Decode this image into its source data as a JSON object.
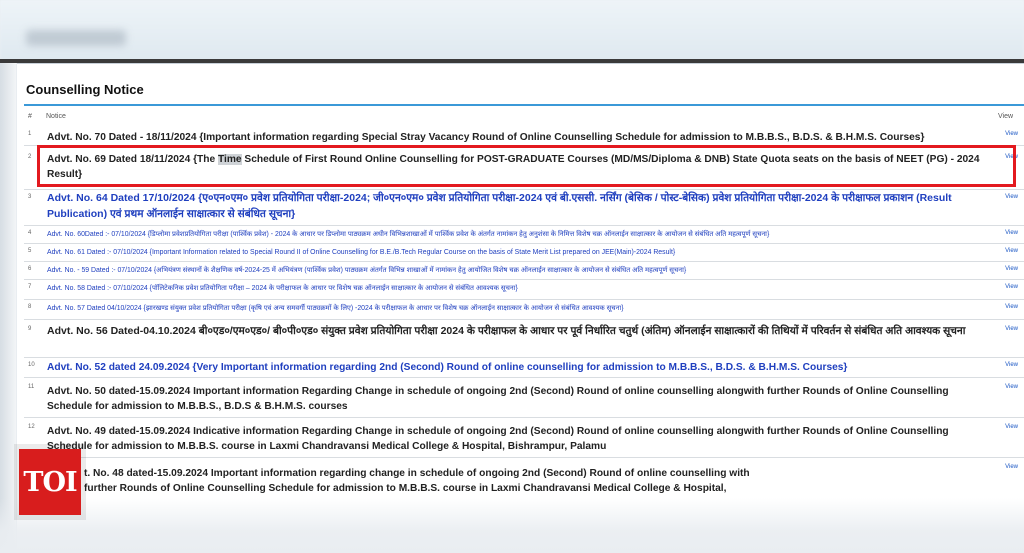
{
  "panel": {
    "title": "Counselling Notice",
    "headers": {
      "num": "#",
      "notice": "Notice",
      "view": "View"
    }
  },
  "rows": [
    {
      "num": "1",
      "view": "View",
      "text": "Advt. No. 70 Dated - 18/11/2024 {Important information regarding Special Stray Vacancy Round of Online Counselling Schedule for admission to M.B.B.S., B.D.S. & B.H.M.S. Courses}"
    },
    {
      "num": "2",
      "view": "View",
      "text_pre": "Advt. No. 69 Dated 18/11/2024 {The ",
      "text_hl": "Time",
      "text_post": " Schedule of First Round Online Counselling for POST-GRADUATE Courses (MD/MS/Diploma & DNB) State Quota seats on the basis of NEET (PG) - 2024 Result}"
    },
    {
      "num": "3",
      "view": "View",
      "text": "Advt. No. 64 Dated 17/10/2024 {ए०एन०एम० प्रवेश प्रतियोगिता परीक्षा-2024; जी०एन०एम० प्रवेश प्रतियोगिता परीक्षा-2024 एवं बी.एससी. नर्सिंग (बेसिक / पोस्ट-बेसिक) प्रवेश प्रतियोगिता परीक्षा-2024 के परीक्षाफल प्रकाशन (Result Publication) एवं प्रथम ऑनलाईन साक्षात्कार से संबंधित सूचना}"
    },
    {
      "num": "4",
      "view": "View",
      "text": "Advt. No. 60Dated :- 07/10/2024 {डिप्लोमा प्रवेशप्रतियोगिता परीक्षा (पार्श्विक प्रवेश) - 2024 के आधार पर डिप्लोमा पाठ्यक्रम अधीन विभिन्नशाखाओं में पार्श्विक प्रवेश के अंतर्गत नामांकन हेतु अनुशंसा के निमित्त विशेष चक्र ऑनलाईन साक्षात्कार के आयोजन से संबंधित अति महत्वपूर्ण सूचना}"
    },
    {
      "num": "5",
      "view": "View",
      "text": "Advt. No. 61 Dated :- 07/10/2024 {Important Information related to Special Round II of Online Counselling for B.E./B.Tech Regular Course on the basis of State Merit List prepared on JEE(Main)-2024 Result}"
    },
    {
      "num": "6",
      "view": "View",
      "text": "Advt. No. - 59 Dated :- 07/10/2024 {अभियंत्रण संस्थानों के शैक्षणिक वर्ष-2024-25 में अभियंत्रण (पार्श्विक प्रवेश) पाठ्यक्रम अंतर्गत विभिन्न शाखाओं में नामांकन हेतु आयोजित विशेष चक्र ऑनलाईन साक्षात्कार के आयोजन से संबंधित अति महत्वपूर्ण सूचना}"
    },
    {
      "num": "7",
      "view": "View",
      "text": "Advt. No. 58 Dated :- 07/10/2024 {पॉलिटेकनिक प्रवेश प्रतियोगिता परीक्षा – 2024 के परीक्षाफल के आधार पर विशेष चक्र ऑनलाईन साक्षात्कार के आयोजन से संबंधित आवश्यक सूचना}"
    },
    {
      "num": "8",
      "view": "View",
      "text": "Advt. No. 57 Dated 04/10/2024 {झारखण्ड संयुक्त प्रवेश प्रतियोगिता परीक्षा (कृषि एवं अन्य समवर्गी पाठ्यक्रमों के लिए) -2024 के परीक्षाफल के आधार पर विशेष चक्र ऑनलाईन साक्षात्कार के आयोजन से संबंधित आवश्यक सूचना}"
    },
    {
      "num": "9",
      "view": "View",
      "text": "Advt. No. 56 Dated-04.10.2024 बी०एड०/एम०एड०/ बी०पी०एड० संयुक्त प्रवेश प्रतियोगिता परीक्षा 2024 के परीक्षाफल के आधार पर पूर्व निर्धारित चतुर्थ (अंतिम) ऑनलाईन साक्षात्कारों की तिथियों में परिवर्तन से संबंधित अति आवश्यक सूचना"
    },
    {
      "num": "10",
      "view": "View",
      "text": "Advt. No. 52 dated 24.09.2024 {Very Important information regarding 2nd  (Second) Round of online counselling for admission to M.B.B.S., B.D.S. & B.H.M.S. Courses}"
    },
    {
      "num": "11",
      "view": "View",
      "text": "Advt. No. 50 dated-15.09.2024 Important information Regarding Change in schedule of ongoing 2nd (Second) Round of online counselling alongwith further Rounds of Online Counselling Schedule for admission to M.B.B.S., B.D.S & B.H.M.S. courses"
    },
    {
      "num": "12",
      "view": "View",
      "text": "Advt. No. 49 dated-15.09.2024 Indicative information Regarding Change in schedule of ongoing 2nd (Second) Round of online counselling alongwith further Rounds of Online Counselling Schedule for admission to M.B.B.S. course in Laxmi Chandravansi Medical College & Hospital, Bishrampur, Palamu"
    },
    {
      "num": "",
      "view": "View",
      "text": "t. No. 48 dated-15.09.2024 Important information regarding change in schedule of ongoing 2nd (Second) Round of online counselling with further Rounds of Online Counselling Schedule for admission to M.B.B.S. course in Laxmi Chandravansi Medical College & Hospital,"
    }
  ],
  "logo": {
    "text": "TOI"
  },
  "colors": {
    "accent_rule": "#3b99d8",
    "highlight_box": "#e3191f",
    "link_blue": "#1f3fbf",
    "logo_red": "#d81d1d"
  }
}
